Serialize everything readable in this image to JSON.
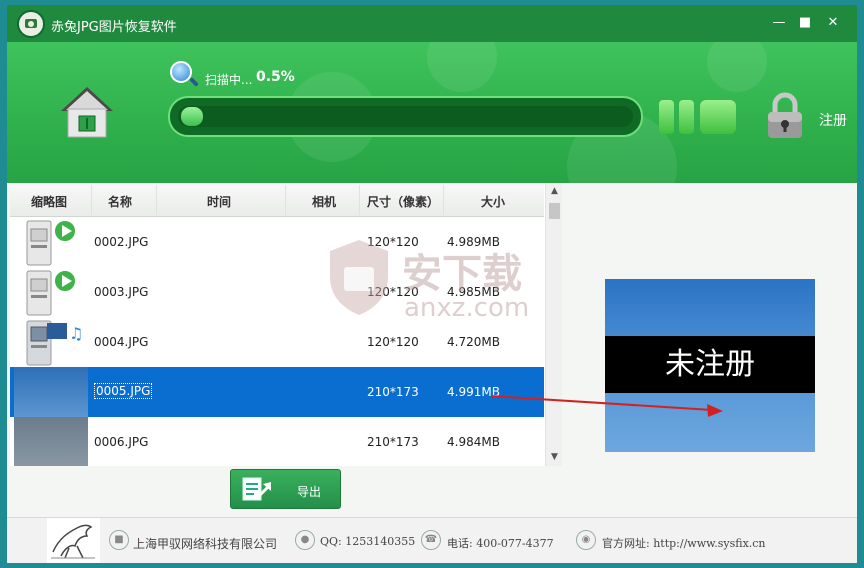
{
  "window": {
    "title": "赤兔JPG图片恢复软件"
  },
  "scan": {
    "status_label": "扫描中...",
    "percent": "0.5%",
    "progress_fraction": 0.005
  },
  "header": {
    "register_label": "注册"
  },
  "table": {
    "headers": [
      "缩略图",
      "名称",
      "时间",
      "相机",
      "尺寸（像素）",
      "大小"
    ],
    "rows": [
      {
        "name": "0002.JPG",
        "time": "",
        "camera": "",
        "dimensions": "120*120",
        "size": "4.989MB",
        "thumb": "disk-play-icon"
      },
      {
        "name": "0003.JPG",
        "time": "",
        "camera": "",
        "dimensions": "120*120",
        "size": "4.985MB",
        "thumb": "disk-play-icon"
      },
      {
        "name": "0004.JPG",
        "time": "",
        "camera": "",
        "dimensions": "120*120",
        "size": "4.720MB",
        "thumb": "disk-media-icon"
      },
      {
        "name": "0005.JPG",
        "time": "",
        "camera": "",
        "dimensions": "210*173",
        "size": "4.991MB",
        "thumb": "sky-photo",
        "selected": true
      },
      {
        "name": "0006.JPG",
        "time": "",
        "camera": "",
        "dimensions": "210*173",
        "size": "4.984MB",
        "thumb": "grey-photo"
      }
    ]
  },
  "preview": {
    "watermark_text": "未注册"
  },
  "watermark": {
    "brand": "安下载",
    "url": "anxz.com"
  },
  "export": {
    "label": "导出"
  },
  "footer": {
    "company": "上海甲驭网络科技有限公司",
    "qq": "QQ: 1253140355",
    "phone": "电话: 400-077-4377",
    "website": "官方网址: http://www.sysfix.cn"
  },
  "colors": {
    "titlebar": "#1f8a3e",
    "header": "#2fb04c",
    "selection": "#0a6ed1",
    "progress_fill": "#3bbf4d",
    "arrow": "#d42020"
  }
}
